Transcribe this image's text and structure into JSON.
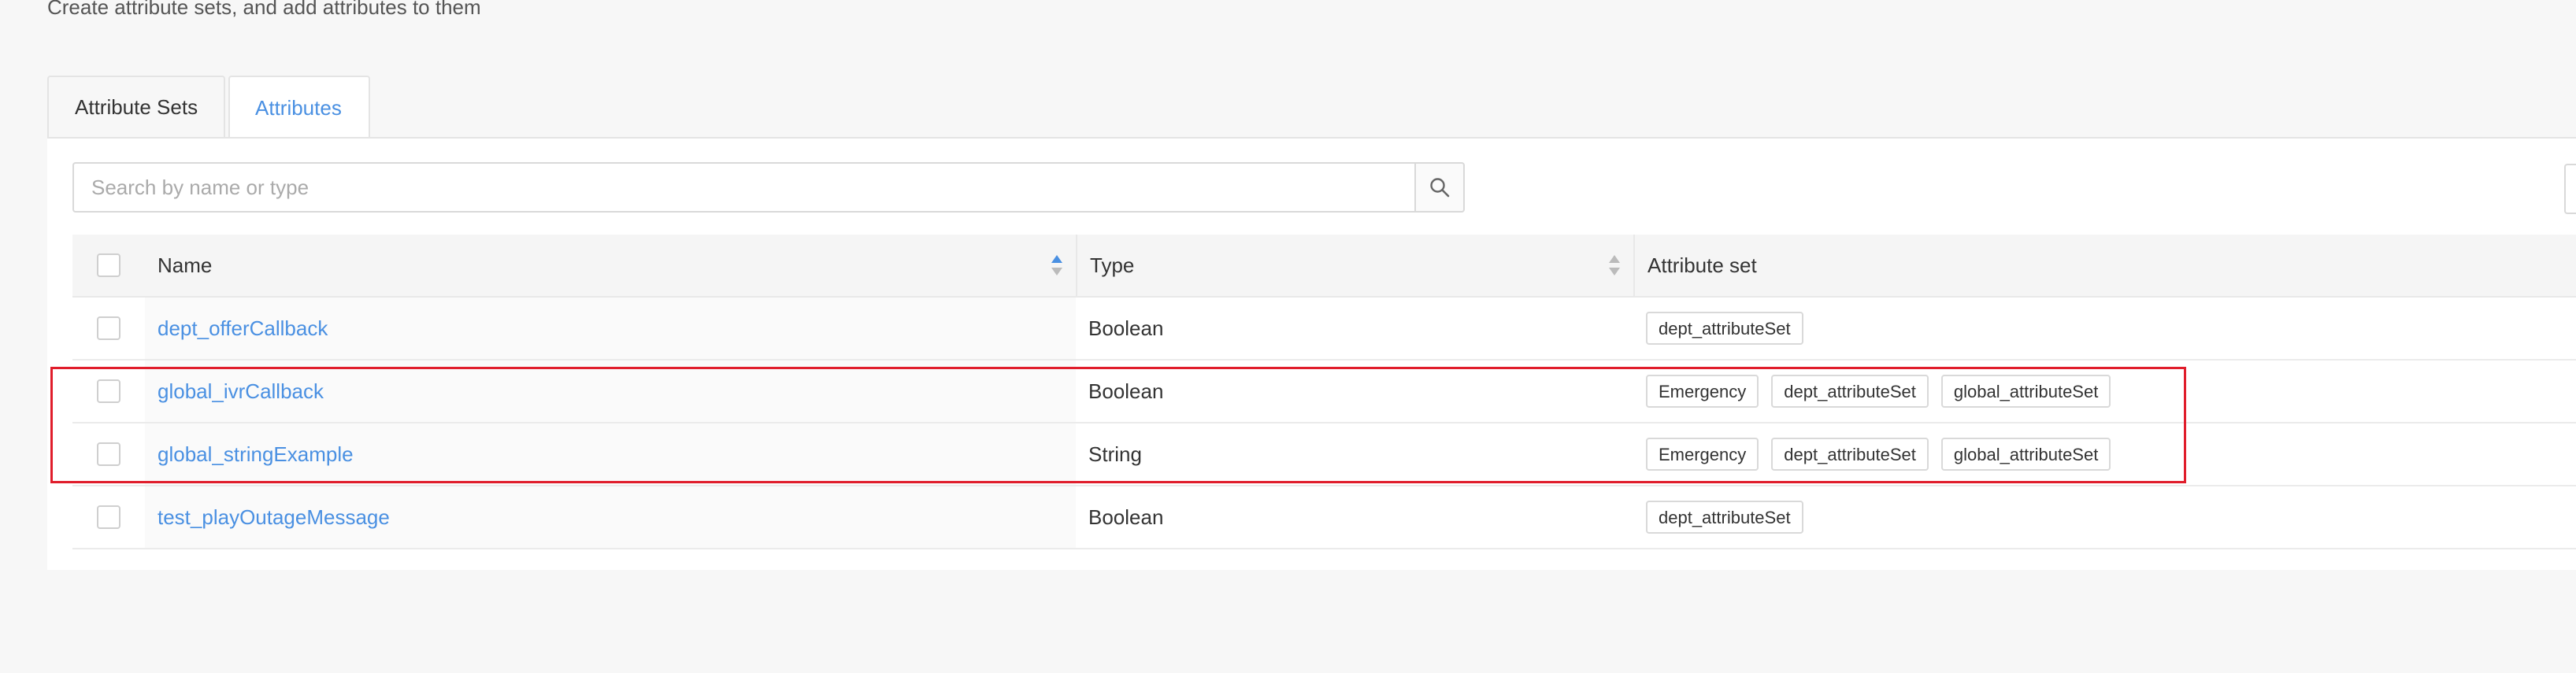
{
  "header": {
    "subtitle": "Create attribute sets, and add attributes to them"
  },
  "tabs": [
    {
      "label": "Attribute Sets",
      "active": false
    },
    {
      "label": "Attributes",
      "active": true
    }
  ],
  "search": {
    "placeholder": "Search by name or type",
    "value": ""
  },
  "table": {
    "columns": [
      "Name",
      "Type",
      "Attribute set"
    ],
    "rows": [
      {
        "name": "dept_offerCallback",
        "type": "Boolean",
        "sets": [
          "dept_attributeSet"
        ]
      },
      {
        "name": "global_ivrCallback",
        "type": "Boolean",
        "sets": [
          "Emergency",
          "dept_attributeSet",
          "global_attributeSet"
        ]
      },
      {
        "name": "global_stringExample",
        "type": "String",
        "sets": [
          "Emergency",
          "dept_attributeSet",
          "global_attributeSet"
        ]
      },
      {
        "name": "test_playOutageMessage",
        "type": "Boolean",
        "sets": [
          "dept_attributeSet"
        ]
      }
    ]
  },
  "colors": {
    "accent": "#4a90e2",
    "highlight": "#e01d2b",
    "background": "#f7f7f7"
  },
  "icons": {
    "search": "search-icon",
    "sort": "sort-icon"
  }
}
